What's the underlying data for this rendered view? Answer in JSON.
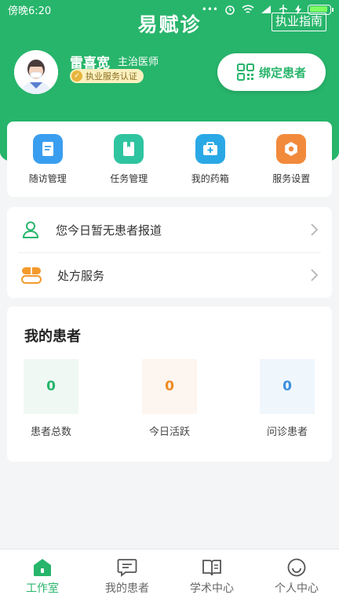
{
  "status_bar": {
    "time": "傍晚6:20",
    "dots": "•••"
  },
  "header": {
    "app_title": "易赋诊",
    "guide_label": "执业指南"
  },
  "profile": {
    "name": "雷喜宽",
    "title": "主治医师",
    "cert_label": "执业服务认证",
    "bind_label": "绑定患者"
  },
  "quick_actions": [
    {
      "label": "随访管理",
      "icon": "follow-up-icon",
      "color": "#3a9ef0"
    },
    {
      "label": "任务管理",
      "icon": "task-book-icon",
      "color": "#2fc4a0"
    },
    {
      "label": "我的药箱",
      "icon": "medicine-box-icon",
      "color": "#2aa8e6"
    },
    {
      "label": "服务设置",
      "icon": "settings-icon",
      "color": "#f28a3c"
    }
  ],
  "notices": [
    {
      "label": "您今日暂无患者报道",
      "icon": "person-icon"
    },
    {
      "label": "处方服务",
      "icon": "prescription-icon"
    }
  ],
  "patients": {
    "title": "我的患者",
    "stats": [
      {
        "value": "0",
        "label": "患者总数",
        "color": "#27b56b",
        "bg": "#f0f8f4"
      },
      {
        "value": "0",
        "label": "今日活跃",
        "color": "#f08a24",
        "bg": "#fdf5ef"
      },
      {
        "value": "0",
        "label": "问诊患者",
        "color": "#3a8fe0",
        "bg": "#eff6fc"
      }
    ]
  },
  "tabs": [
    {
      "label": "工作室",
      "icon": "home-icon",
      "active": true
    },
    {
      "label": "我的患者",
      "icon": "chat-icon",
      "active": false
    },
    {
      "label": "学术中心",
      "icon": "book-icon",
      "active": false
    },
    {
      "label": "个人中心",
      "icon": "smile-icon",
      "active": false
    }
  ],
  "colors": {
    "brand": "#27b56b"
  }
}
